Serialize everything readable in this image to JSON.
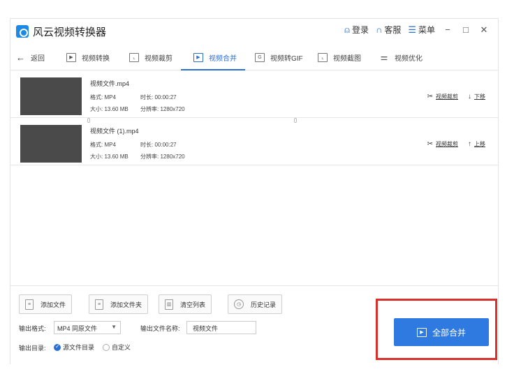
{
  "app": {
    "title": "风云视频转换器"
  },
  "titlebar": {
    "login_label": "登录",
    "service_label": "客服",
    "menu_label": "菜单",
    "minimize": "−",
    "maximize": "□",
    "close": "✕"
  },
  "nav": {
    "back_label": "返回",
    "tabs": [
      {
        "label": "视频转换"
      },
      {
        "label": "视频裁剪"
      },
      {
        "label": "视频合并"
      },
      {
        "label": "视频转GIF"
      },
      {
        "label": "视频截图"
      },
      {
        "label": "视频优化"
      }
    ],
    "active_tab": "视频合并"
  },
  "files": [
    {
      "name": "视频文件.mp4",
      "format_label": "格式:",
      "format": "MP4",
      "duration_label": "时长:",
      "duration": "00:00:27",
      "size_label": "大小:",
      "size": "13.60 MB",
      "resolution_label": "分辨率:",
      "resolution": "1280x720",
      "edit_label": "视频裁剪",
      "move_label": "下移"
    },
    {
      "name": "视频文件 (1).mp4",
      "format_label": "格式:",
      "format": "MP4",
      "duration_label": "时长:",
      "duration": "00:00:27",
      "size_label": "大小:",
      "size": "13.60 MB",
      "resolution_label": "分辨率:",
      "resolution": "1280x720",
      "edit_label": "视频裁剪",
      "move_label": "上移"
    }
  ],
  "bottom": {
    "add_file": "添加文件",
    "add_folder": "添加文件夹",
    "clear_list": "清空列表",
    "history": "历史记录",
    "output_format_label": "输出格式:",
    "output_format_value": "MP4 同原文件",
    "output_name_label": "输出文件名称:",
    "output_name_value": "视频文件",
    "output_dir_label": "输出目录:",
    "dir_option_source": "源文件目录",
    "dir_option_custom": "自定义",
    "merge_all": "全部合并"
  },
  "colors": {
    "accent": "#2f7ae0",
    "highlight": "#d9302c",
    "thumb": "#4a4a4a"
  }
}
